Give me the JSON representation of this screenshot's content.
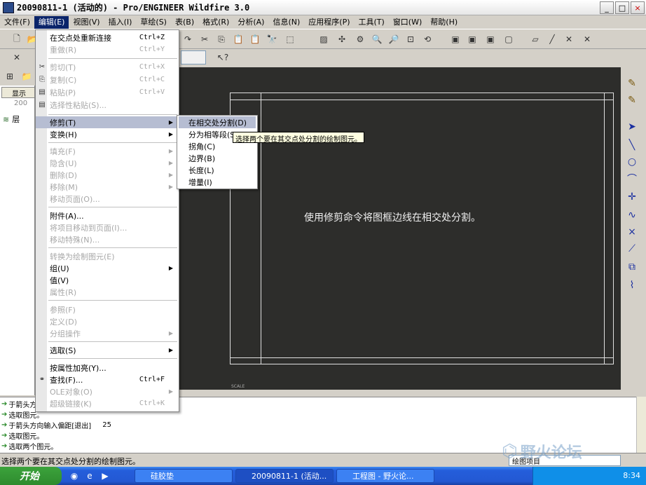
{
  "window": {
    "title": "20090811-1 (活动的) - Pro/ENGINEER Wildfire 3.0",
    "min": "_",
    "max": "□",
    "close": "×"
  },
  "menubar": [
    "文件(F)",
    "编辑(E)",
    "视图(V)",
    "插入(I)",
    "草绘(S)",
    "表(B)",
    "格式(R)",
    "分析(A)",
    "信息(N)",
    "应用程序(P)",
    "工具(T)",
    "窗口(W)",
    "帮助(H)"
  ],
  "left_panel": {
    "show_label": "显示",
    "combo_value": "200",
    "layer_label": "层"
  },
  "edit_menu": {
    "items": [
      {
        "label": "在交点处重新连接",
        "shortcut": "Ctrl+Z",
        "disabled": false
      },
      {
        "label": "重做(R)",
        "shortcut": "Ctrl+Y",
        "disabled": true
      },
      {
        "label": "剪切(T)",
        "shortcut": "Ctrl+X",
        "disabled": true
      },
      {
        "label": "复制(C)",
        "shortcut": "Ctrl+C",
        "disabled": true
      },
      {
        "label": "粘贴(P)",
        "shortcut": "Ctrl+V",
        "disabled": true
      },
      {
        "label": "选择性粘贴(S)...",
        "shortcut": "",
        "disabled": true
      },
      {
        "label": "修剪(T)",
        "shortcut": "",
        "disabled": false,
        "submenu": true,
        "highlighted": true
      },
      {
        "label": "变换(H)",
        "shortcut": "",
        "disabled": false,
        "submenu": true
      },
      {
        "label": "填充(F)",
        "shortcut": "",
        "disabled": true,
        "submenu": true
      },
      {
        "label": "隐含(U)",
        "shortcut": "",
        "disabled": true,
        "submenu": true
      },
      {
        "label": "删除(D)",
        "shortcut": "",
        "disabled": true,
        "submenu": true
      },
      {
        "label": "移除(M)",
        "shortcut": "",
        "disabled": true,
        "submenu": true
      },
      {
        "label": "移动页面(O)...",
        "shortcut": "",
        "disabled": true
      },
      {
        "label": "附件(A)...",
        "shortcut": "",
        "disabled": false
      },
      {
        "label": "将项目移动到页面(I)...",
        "shortcut": "",
        "disabled": true
      },
      {
        "label": "移动特殊(N)...",
        "shortcut": "",
        "disabled": true
      },
      {
        "label": "转换为绘制图元(E)",
        "shortcut": "",
        "disabled": true
      },
      {
        "label": "组(U)",
        "shortcut": "",
        "disabled": false,
        "submenu": true
      },
      {
        "label": "值(V)",
        "shortcut": "",
        "disabled": false
      },
      {
        "label": "属性(R)",
        "shortcut": "",
        "disabled": true
      },
      {
        "label": "参照(F)",
        "shortcut": "",
        "disabled": true
      },
      {
        "label": "定义(D)",
        "shortcut": "",
        "disabled": true
      },
      {
        "label": "分组操作",
        "shortcut": "",
        "disabled": true,
        "submenu": true
      },
      {
        "label": "选取(S)",
        "shortcut": "",
        "disabled": false,
        "submenu": true
      },
      {
        "label": "按属性加亮(Y)...",
        "shortcut": "",
        "disabled": false
      },
      {
        "label": "查找(F)...",
        "shortcut": "Ctrl+F",
        "disabled": false
      },
      {
        "label": "OLE对象(O)",
        "shortcut": "",
        "disabled": true,
        "submenu": true
      },
      {
        "label": "超级链接(K)",
        "shortcut": "Ctrl+K",
        "disabled": true
      }
    ]
  },
  "trim_submenu": {
    "items": [
      "在相交处分割(D)",
      "分为相等段(S)",
      "拐角(C)",
      "边界(B)",
      "长度(L)",
      "增量(I)"
    ]
  },
  "tooltip": "选择两个要在其交点处分割的绘制图元。",
  "graphics": {
    "note": "使用修剪命令将图框边线在相交处分割。",
    "scale": "SCALE"
  },
  "messages": [
    {
      "text": "于箭头方向输入偏距[退出]",
      "value": ""
    },
    {
      "text": "选取图元。",
      "value": ""
    },
    {
      "text": "于箭头方向输入偏距[退出]",
      "value": "25"
    },
    {
      "text": "选取图元。",
      "value": ""
    },
    {
      "text": "选取两个图元。",
      "value": ""
    }
  ],
  "status": {
    "text": "选择两个要在其交点处分割的绘制图元。",
    "combo": "绘图项目"
  },
  "taskbar": {
    "start": "开始",
    "tasks": [
      "硅胶垫",
      "20090811-1 (活动...",
      "工程图 - 野火论..."
    ],
    "clock": "8:34"
  },
  "watermark": "野火论坛"
}
